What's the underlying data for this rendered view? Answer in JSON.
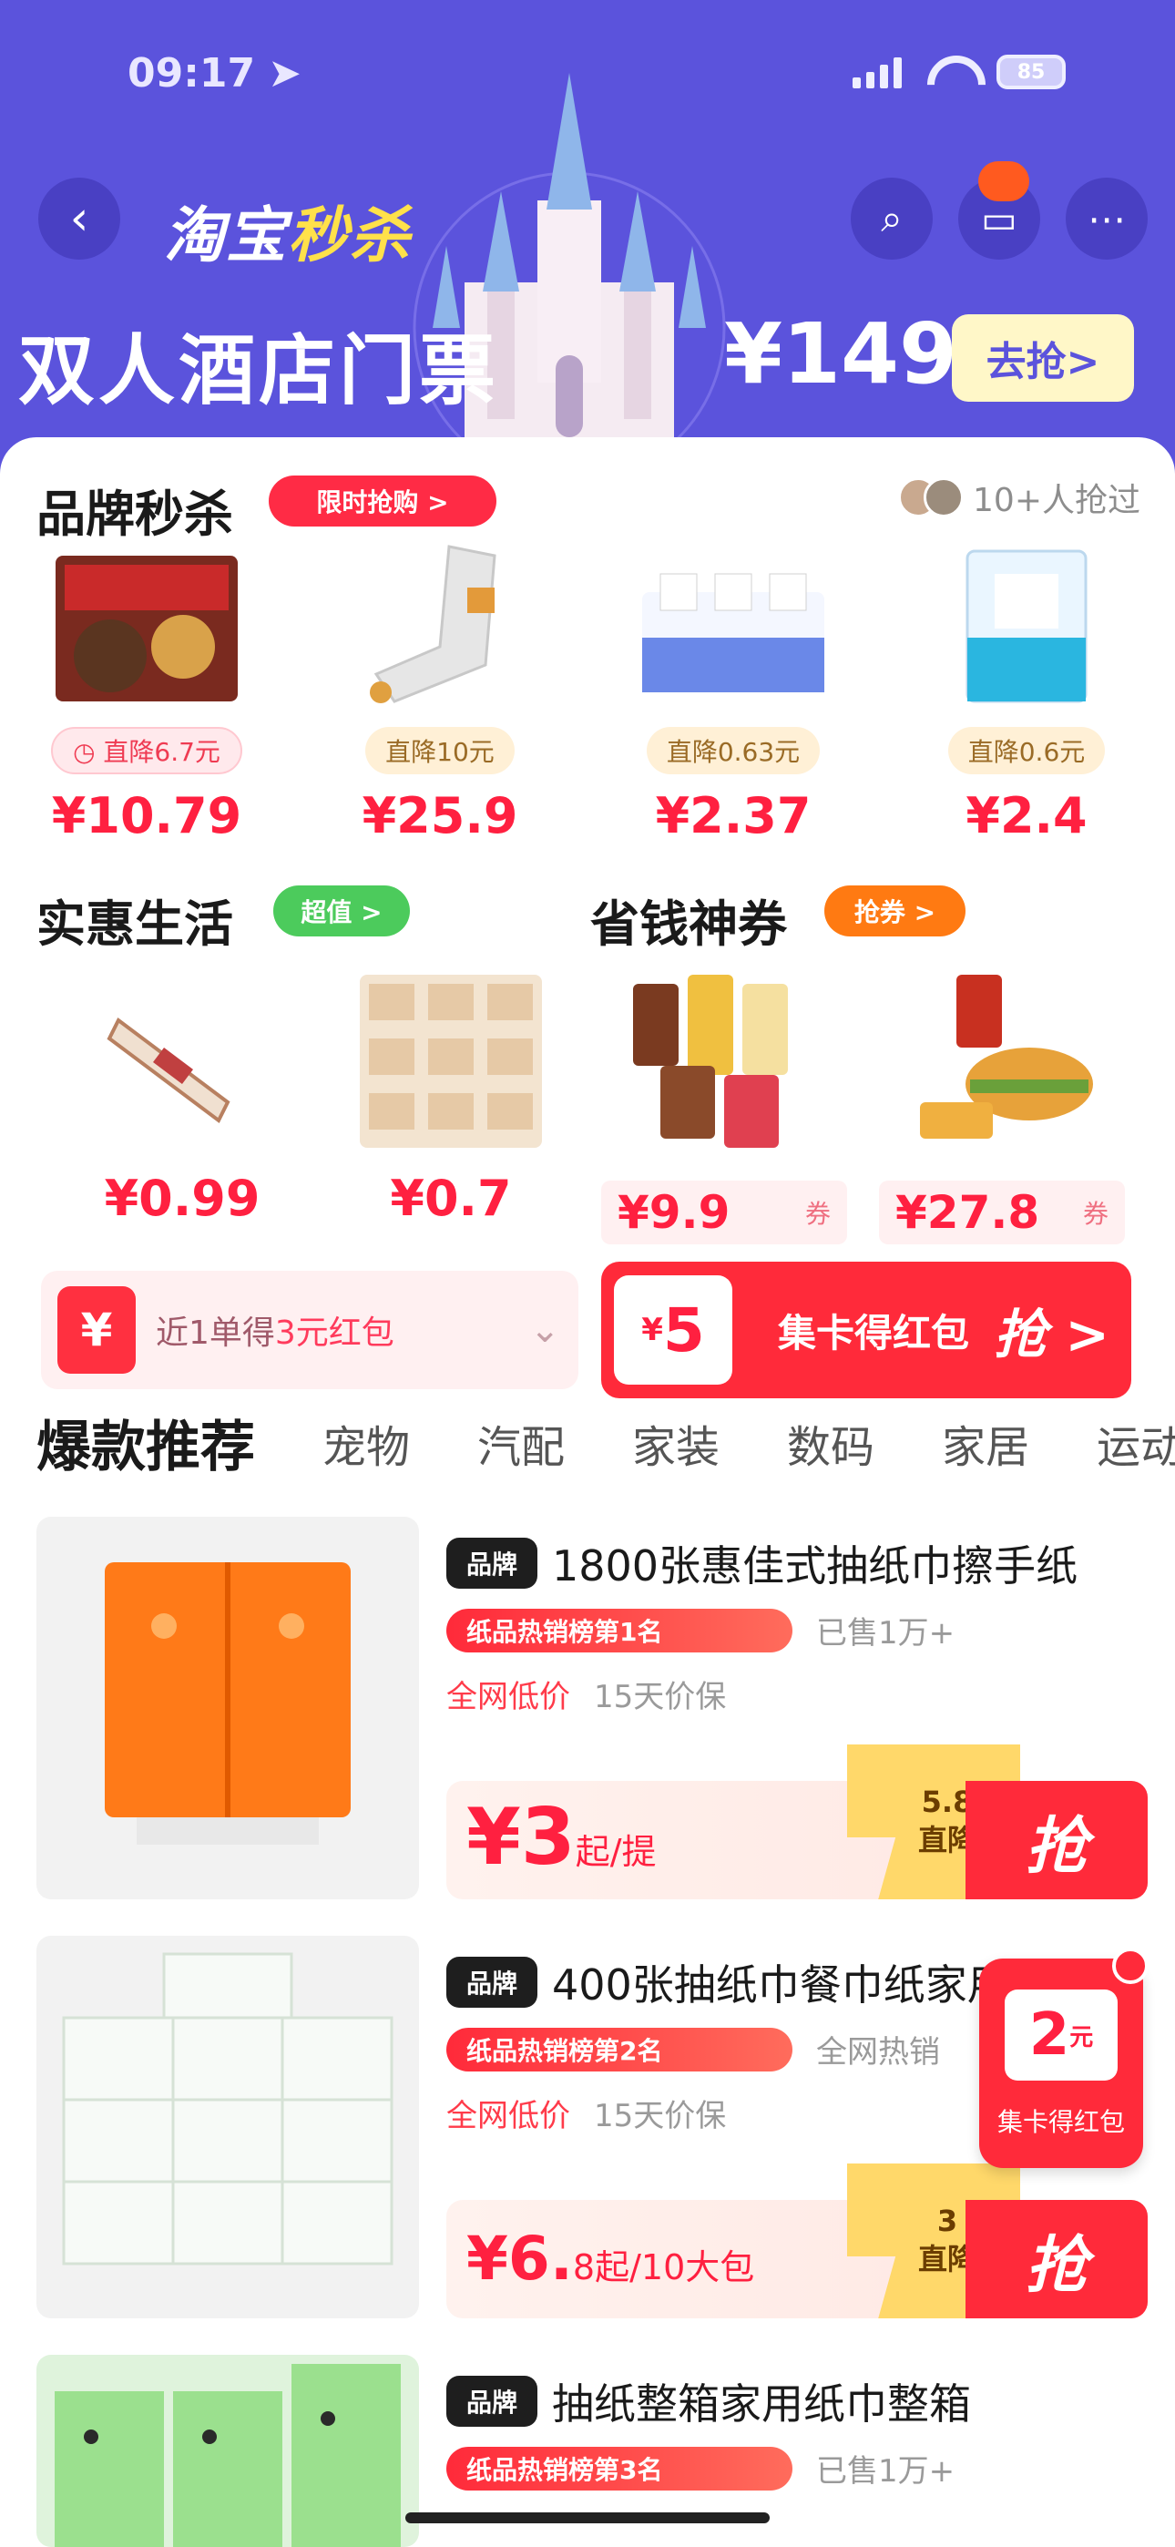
{
  "status_bar": {
    "time": "09:17",
    "battery": "85"
  },
  "header": {
    "back_icon": "chevron-left-icon",
    "brand_prefix": "淘宝",
    "brand_suffix": "秒杀",
    "promo_text": "双人酒店门票",
    "promo_price": "¥1499",
    "promo_button": "去抢>",
    "icons": [
      "search-icon",
      "cart-icon",
      "more-icon"
    ]
  },
  "brand_section": {
    "title": "品牌秒杀",
    "badge": "限时抢购 >",
    "participants": "10+人抢过",
    "items": [
      {
        "tag": "◷ 直降6.7元",
        "price": "¥10.79"
      },
      {
        "tag": "直降10元",
        "price": "¥25.9"
      },
      {
        "tag": "直降0.63元",
        "price": "¥2.37"
      },
      {
        "tag": "直降0.6元",
        "price": "¥2.4"
      }
    ]
  },
  "life_section": {
    "title": "实惠生活",
    "badge": "超值 >",
    "items": [
      {
        "price": "¥0.99"
      },
      {
        "price": "¥0.7"
      }
    ]
  },
  "save_section": {
    "title": "省钱神券",
    "badge": "抢券 >",
    "items": [
      {
        "price": "¥9.9",
        "tail": "券"
      },
      {
        "price": "¥27.8",
        "tail": "券"
      }
    ]
  },
  "coupons": {
    "left_text": "近1单得",
    "left_highlight": "3元红包",
    "right_amount": "5",
    "right_text": "集卡得红包",
    "right_button": "抢 >"
  },
  "tabs": {
    "main": "爆款推荐",
    "items": [
      "宠物",
      "汽配",
      "家装",
      "数码",
      "家居",
      "运动"
    ]
  },
  "products": [
    {
      "tag": "品牌",
      "title": "1800张惠佳式抽纸巾擦手纸",
      "rank": "纸品热销榜第1名",
      "sold": "已售1万+",
      "meta_hot": "全网低价",
      "meta_other": "15天价保",
      "price": "¥3",
      "unit": "起/提",
      "save_line1": "直降",
      "save_line2": "5.8",
      "button": "抢"
    },
    {
      "tag": "品牌",
      "title": "400张抽纸巾餐巾纸家用",
      "rank": "纸品热销榜第2名",
      "sold": "全网热销",
      "meta_hot": "全网低价",
      "meta_other": "15天价保",
      "price": "¥6.",
      "unit": "8起/10大包",
      "save_line1": "直降",
      "save_line2": "3",
      "button": "抢"
    },
    {
      "tag": "品牌",
      "title": "抽纸整箱家用纸巾整箱",
      "rank": "纸品热销榜第3名",
      "sold": "已售1万+"
    }
  ],
  "floating_redpacket": {
    "amount": "2",
    "unit": "元",
    "label": "集卡得红包"
  },
  "colors": {
    "header": "#5b53dc",
    "accent_red": "#ff2040",
    "brand_yellow": "#ffe14a"
  }
}
